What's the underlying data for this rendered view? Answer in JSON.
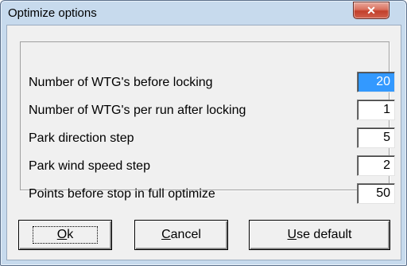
{
  "window": {
    "title": "Optimize options",
    "close_glyph": "✕"
  },
  "fields": [
    {
      "label": "Number of WTG's before locking",
      "value": "20",
      "selected": true
    },
    {
      "label": "Number of WTG's per run after locking",
      "value": "1",
      "selected": false
    },
    {
      "label": "Park direction step",
      "value": "5",
      "selected": false
    },
    {
      "label": "Park wind speed step",
      "value": "2",
      "selected": false
    },
    {
      "label": "Points before stop in full optimize",
      "value": "50",
      "selected": false
    }
  ],
  "buttons": {
    "ok": {
      "mnemonic": "O",
      "rest": "k"
    },
    "cancel": {
      "mnemonic": "C",
      "rest": "ancel"
    },
    "use_default": {
      "mnemonic": "U",
      "rest": "se default"
    }
  },
  "colors": {
    "selection": "#3399ff",
    "close_button": "#c94c39",
    "dialog_face": "#f0f0f0"
  }
}
